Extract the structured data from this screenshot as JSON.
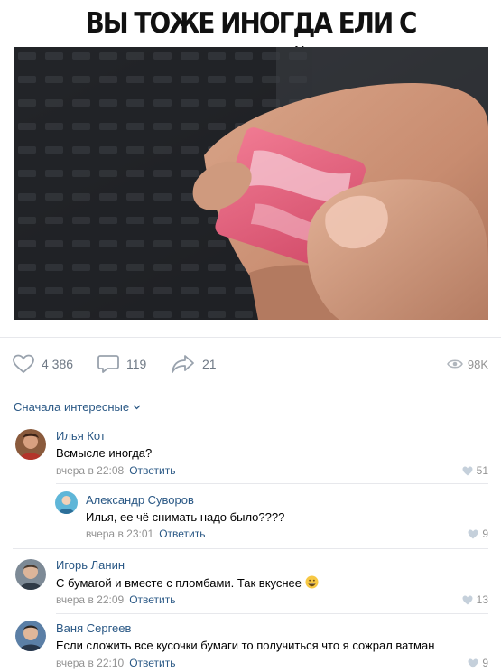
{
  "post": {
    "headline": "ВЫ ТОЖЕ ИНОГДА ЕЛИ С БУМАГОЙ?",
    "likes": "4 386",
    "comments": "119",
    "shares": "21",
    "views": "98K"
  },
  "sort_label": "Сначала интересные",
  "comments": [
    {
      "author": "Илья Кот",
      "text": "Всмысле иногда?",
      "time": "вчера в 22:08",
      "reply": "Ответить",
      "likes": "51"
    },
    {
      "author": "Александр Суворов",
      "text": "Илья, ее чё снимать надо было????",
      "time": "вчера в 23:01",
      "reply": "Ответить",
      "likes": "9"
    },
    {
      "author": "Игорь Ланин",
      "text": "С бумагой и вместе с пломбами. Так вкуснее",
      "time": "вчера в 22:09",
      "reply": "Ответить",
      "likes": "13"
    },
    {
      "author": "Ваня Сергеев",
      "text": "Если сложить все кусочки бумаги то получиться что я сожрал ватман",
      "time": "вчера в 22:10",
      "reply": "Ответить",
      "likes": "9"
    }
  ],
  "colors": {
    "link": "#2a5885",
    "meta": "#939393",
    "icon": "#99a2ad",
    "gum": "#e05a78"
  }
}
